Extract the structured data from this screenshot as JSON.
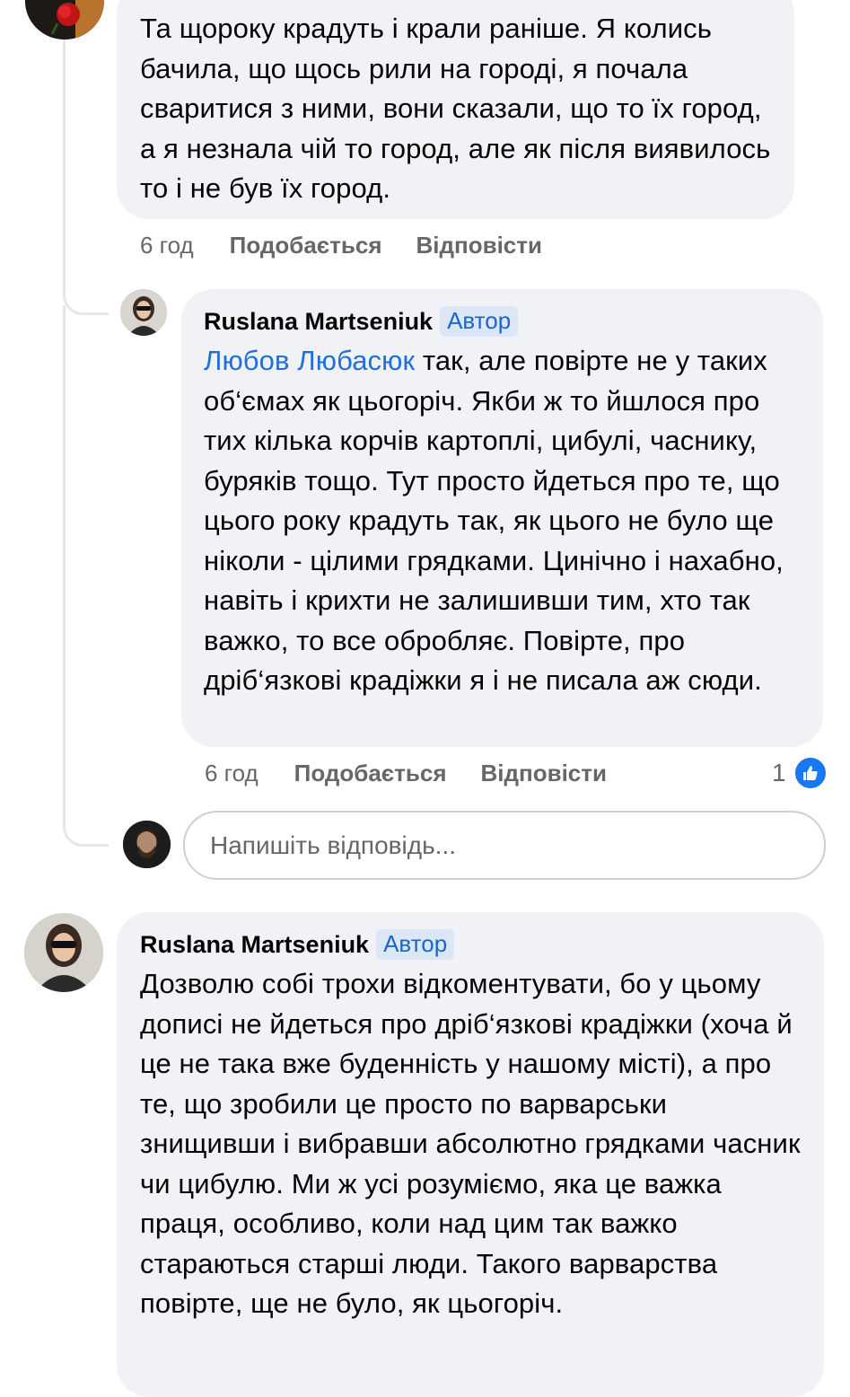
{
  "comments": [
    {
      "text": "Та щороку крадуть і крали раніше. Я колись бачила, що щось рили на городі, я почала сваритися з ними, вони сказали, що то їх город, а я незнала чій то город, але як після виявилось то і не був їх город.",
      "time": "6 год",
      "like_label": "Подобається",
      "reply_label": "Відповісти",
      "avatar_icon": "rose-avatar"
    },
    {
      "author": "Ruslana Martseniuk",
      "badge": "Автор",
      "mention": "Любов Любасюк",
      "text": " так, але повірте не у таких об‘ємах як цьогоріч. Якби ж то йшлося про тих кілька корчів картоплі, цибулі, часнику, буряків тощо. Тут просто йдеться про те, що цього року крадуть так, як цього не було ще ніколи - цілими грядками. Цинічно і нахабно, навіть і крихти не залишивши тим, хто так важко, то все обробляє. Повірте, про дріб‘язкові крадіжки я і не писала аж сюди.",
      "time": "6 год",
      "like_label": "Подобається",
      "reply_label": "Відповісти",
      "reaction_count": "1",
      "reaction_icon": "like-thumb-icon"
    },
    {
      "author": "Ruslana Martseniuk",
      "badge": "Автор",
      "text": "Дозволю собі трохи відкоментувати, бо у цьому дописі не йдеться про дріб‘язкові крадіжки (хоча й це не така вже буденність у нашому місті), а про те, що зробили це просто по варварськи знищивши і вибравши абсолютно грядками часник чи цибулю. Ми ж усі розуміємо, яка це важка праця, особливо, коли над цим так важко стараються старші люди.  Такого варварства повірте, ще не було, як цьогоріч."
    }
  ],
  "reply_input": {
    "placeholder": "Напишіть відповідь..."
  },
  "colors": {
    "bubble": "#f0f2f5",
    "badge_bg": "#dbe7f7",
    "badge_text": "#1b66c9",
    "mention": "#216fdb",
    "meta": "#65676b",
    "like": "#1877f2"
  }
}
